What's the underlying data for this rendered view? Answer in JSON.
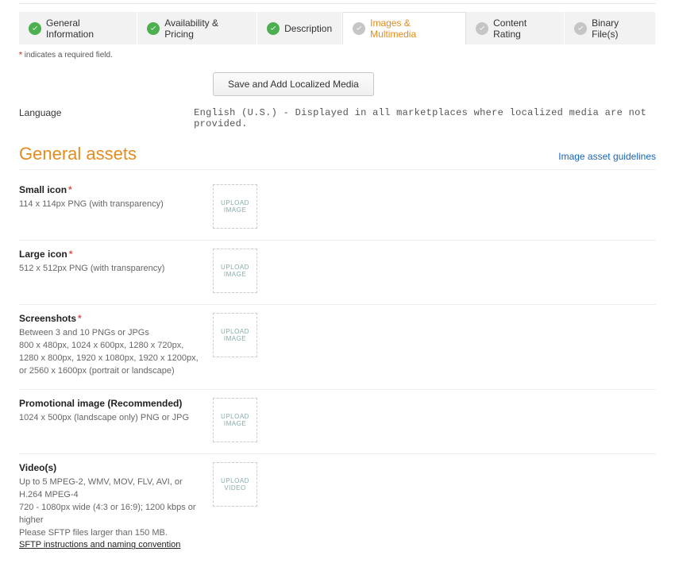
{
  "tabs": [
    {
      "label": "General Information",
      "status": "done"
    },
    {
      "label": "Availability & Pricing",
      "status": "done"
    },
    {
      "label": "Description",
      "status": "done"
    },
    {
      "label": "Images & Multimedia",
      "status": "pending",
      "active": true
    },
    {
      "label": "Content Rating",
      "status": "pending"
    },
    {
      "label": "Binary File(s)",
      "status": "pending"
    }
  ],
  "required_note": {
    "star": "*",
    "text": "indicates a required field."
  },
  "buttons": {
    "save_localized": "Save and Add Localized Media"
  },
  "language": {
    "label": "Language",
    "value": "English (U.S.)  - Displayed in all marketplaces where localized media are not provided."
  },
  "section": {
    "title": "General assets",
    "guidelines_link": "Image asset guidelines"
  },
  "upload": {
    "image_l1": "UPLOAD",
    "image_l2": "IMAGE",
    "video_l1": "UPLOAD",
    "video_l2": "VIDEO"
  },
  "assets": {
    "small_icon": {
      "title": "Small icon",
      "required": true,
      "desc": [
        "114 x 114px PNG (with transparency)"
      ]
    },
    "large_icon": {
      "title": "Large icon",
      "required": true,
      "desc": [
        "512 x 512px PNG (with transparency)"
      ]
    },
    "screenshots": {
      "title": "Screenshots",
      "required": true,
      "desc": [
        "Between 3 and 10 PNGs or JPGs",
        "800 x 480px, 1024 x 600px, 1280 x 720px,",
        "1280 x 800px, 1920 x 1080px, 1920 x 1200px,",
        "or 2560 x 1600px (portrait or landscape)"
      ]
    },
    "promo": {
      "title": "Promotional image (Recommended)",
      "required": false,
      "desc": [
        "1024 x 500px (landscape only) PNG or JPG"
      ]
    },
    "videos": {
      "title": "Video(s)",
      "required": false,
      "desc": [
        "Up to 5 MPEG-2, WMV, MOV, FLV, AVI, or H.264 MPEG-4",
        "720 - 1080px wide (4:3 or 16:9); 1200 kbps or higher",
        "Please SFTP files larger than 150 MB."
      ],
      "link": "SFTP instructions and naming convention"
    }
  }
}
